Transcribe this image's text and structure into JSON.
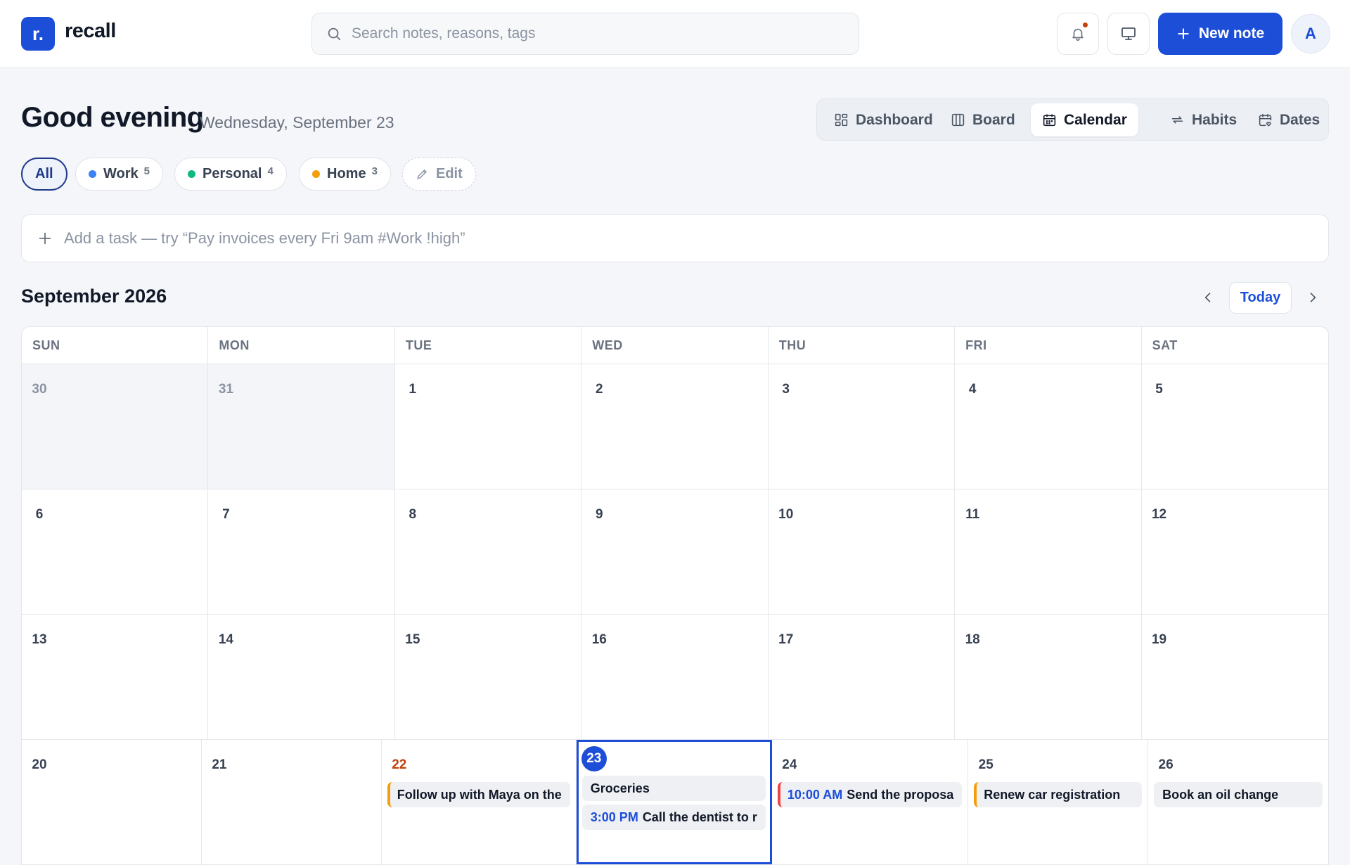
{
  "app": {
    "logo_mark": "r.",
    "name": "recall"
  },
  "search": {
    "placeholder": "Search notes, reasons, tags"
  },
  "header": {
    "new_note_label": "New note",
    "avatar_initial": "A"
  },
  "greeting": {
    "title": "Good evening",
    "date": "Wednesday, September 23"
  },
  "views": [
    {
      "label": "Dashboard",
      "icon": "dashboard-icon",
      "active": false
    },
    {
      "label": "Board",
      "icon": "board-columns-icon",
      "active": false
    },
    {
      "label": "Calendar",
      "icon": "calendar-icon",
      "active": true
    },
    {
      "label": "Habits",
      "icon": "repeat-icon",
      "active": false
    },
    {
      "label": "Dates",
      "icon": "calendar-heart-icon",
      "active": false
    }
  ],
  "filters": {
    "all_label": "All",
    "chips": [
      {
        "label": "Work",
        "count": "5",
        "color": "#3b82f6"
      },
      {
        "label": "Personal",
        "count": "4",
        "color": "#10b981"
      },
      {
        "label": "Home",
        "count": "3",
        "color": "#f59e0b"
      }
    ],
    "edit_label": "Edit"
  },
  "add_task": {
    "placeholder": "Add a task — try “Pay invoices every Fri 9am #Work !high”"
  },
  "calendar": {
    "month_title": "September 2026",
    "today_label": "Today",
    "weekdays": [
      "SUN",
      "MON",
      "TUE",
      "WED",
      "THU",
      "FRI",
      "SAT"
    ],
    "weeks": [
      [
        "30",
        "31",
        "1",
        "2",
        "3",
        "4",
        "5"
      ],
      [
        "6",
        "7",
        "8",
        "9",
        "10",
        "11",
        "12"
      ],
      [
        "13",
        "14",
        "15",
        "16",
        "17",
        "18",
        "19"
      ],
      [
        "20",
        "21",
        "22",
        "23",
        "24",
        "25",
        "26"
      ]
    ],
    "outside_days": [
      "30",
      "31"
    ],
    "events": {
      "tue_22": {
        "title": "Follow up with Maya on the",
        "flag_color": "#f59e0b"
      },
      "wed_23_a": {
        "title": "Groceries"
      },
      "wed_23_b": {
        "time": "3:00 PM",
        "title": "Call the dentist to r"
      },
      "thu_24": {
        "time": "10:00 AM",
        "title": "Send the proposa",
        "flag_color": "#ef4444"
      },
      "fri_25": {
        "title": "Renew car registration",
        "flag_color": "#f59e0b"
      },
      "sat_26": {
        "title": "Book an oil change"
      }
    }
  },
  "colors": {
    "accent": "#1d4ed8",
    "overdue": "#c2410c",
    "notification": "#c2410c"
  }
}
